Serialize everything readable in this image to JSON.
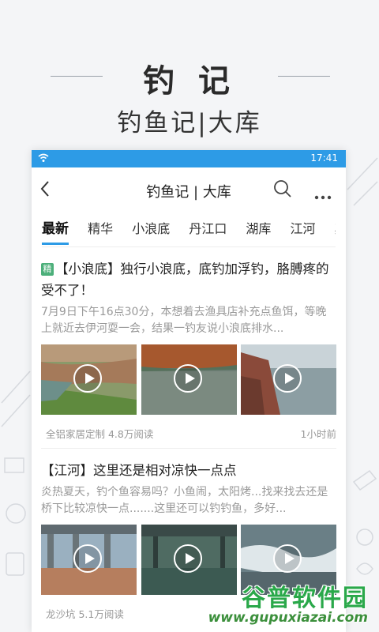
{
  "promo": {
    "title": "钓 记",
    "subtitle": "钓鱼记|大库"
  },
  "status_bar": {
    "time": "17:41",
    "icon": "wifi-icon"
  },
  "navbar": {
    "title": "钓鱼记 | 大库",
    "back_icon": "chevron-left-icon",
    "search_icon": "search-icon",
    "more_icon": "more-icon"
  },
  "tabs": [
    {
      "label": "最新",
      "active": true
    },
    {
      "label": "精华",
      "active": false
    },
    {
      "label": "小浪底",
      "active": false
    },
    {
      "label": "丹江口",
      "active": false
    },
    {
      "label": "湖库",
      "active": false
    },
    {
      "label": "江河",
      "active": false
    },
    {
      "label": "其",
      "active": false
    }
  ],
  "colors": {
    "accent": "#2d9be6",
    "badge": "#4caf7a"
  },
  "articles": [
    {
      "badge": "精",
      "headline": "【小浪底】独行小浪底，底钓加浮钓，胳膊疼的受不了！",
      "excerpt": "7月9日下午16点30分，本想着去渔具店补充点鱼饵，等晚上就近去伊河耍一会，结果一钓友说小浪底排水...",
      "author_reads": "全铝家居定制 4.8万阅读",
      "time": "1小时前"
    },
    {
      "headline": "【江河】这里还是相对凉快一点点",
      "excerpt": "炎热夏天，钓个鱼容易吗？小鱼闹，太阳烤...找来找去还是桥下比较凉快一点.......这里还可以钓钓鱼，多好...",
      "author_reads": "龙沙坑 5.1万阅读"
    }
  ],
  "watermark": {
    "name": "谷普软件园",
    "url": "www.gupuxiazai.com"
  }
}
